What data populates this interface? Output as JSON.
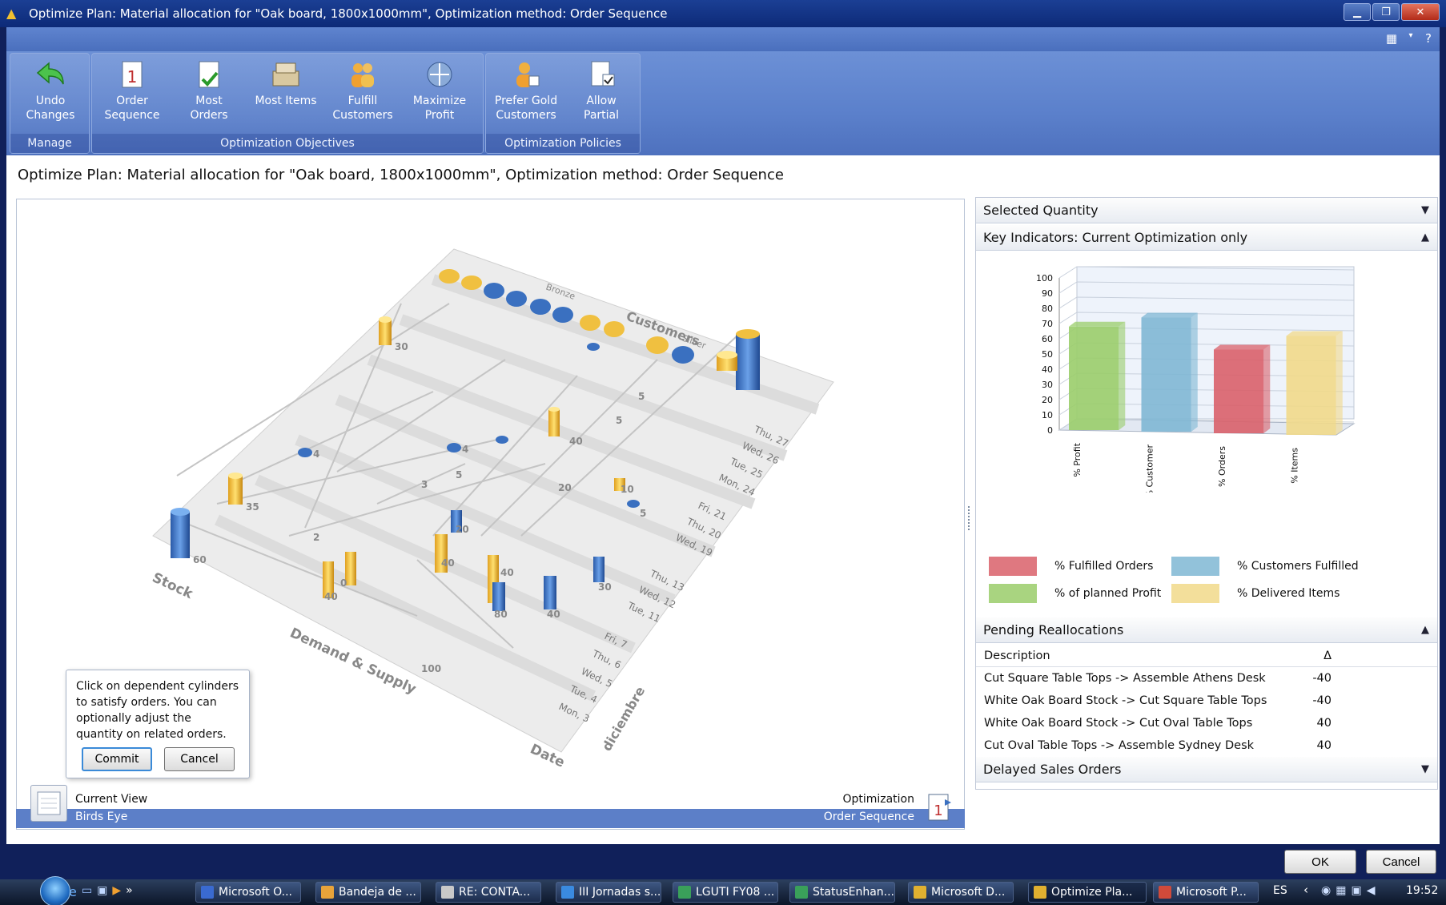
{
  "window": {
    "title": "Optimize Plan: Material allocation for \"Oak board, 1800x1000mm\", Optimization method: Order Sequence"
  },
  "ribbon": {
    "groups": [
      {
        "title": "Manage",
        "buttons": [
          {
            "line1": "Undo",
            "line2": "Changes",
            "icon": "undo-arrow-icon"
          }
        ]
      },
      {
        "title": "Optimization Objectives",
        "buttons": [
          {
            "line1": "Order",
            "line2": "Sequence",
            "icon": "order-sequence-icon"
          },
          {
            "line1": "Most",
            "line2": "Orders",
            "icon": "most-orders-icon"
          },
          {
            "line1": "Most Items",
            "line2": "",
            "icon": "most-items-icon"
          },
          {
            "line1": "Fulfill",
            "line2": "Customers",
            "icon": "fulfill-customers-icon"
          },
          {
            "line1": "Maximize",
            "line2": "Profit",
            "icon": "maximize-profit-icon"
          }
        ]
      },
      {
        "title": "Optimization Policies",
        "buttons": [
          {
            "line1": "Prefer Gold",
            "line2": "Customers",
            "icon": "gold-customer-icon"
          },
          {
            "line1": "Allow",
            "line2": "Partial",
            "icon": "allow-partial-icon"
          }
        ]
      }
    ]
  },
  "page": {
    "title": "Optimize Plan: Material allocation for \"Oak board, 1800x1000mm\", Optimization method: Order Sequence"
  },
  "view3d": {
    "axis_labels": {
      "customers": "Customers",
      "stock": "Stock",
      "demand": "Demand & Supply",
      "date": "Date",
      "month": "diciembre"
    },
    "tier_labels": {
      "bronze": "Bronze",
      "silver": "Silver"
    },
    "dates": [
      "Thu, 27",
      "Wed, 26",
      "Tue, 25",
      "Mon, 24",
      "Fri, 21",
      "Thu, 20",
      "Wed, 19",
      "Thu, 13",
      "Wed, 12",
      "Tue, 11",
      "Fri, 7",
      "Thu, 6",
      "Wed, 5",
      "Tue, 4",
      "Mon, 3"
    ],
    "quantities": [
      "30",
      "35",
      "60",
      "40",
      "100",
      "40",
      "20",
      "20",
      "10",
      "5",
      "30",
      "40",
      "80",
      "40",
      "5",
      "5",
      "4",
      "4",
      "2",
      "3",
      "5",
      "0",
      "40"
    ],
    "current_view_label": "Current View",
    "current_view_value": "Birds Eye",
    "optimization_label": "Optimization",
    "optimization_value": "Order Sequence"
  },
  "tip": {
    "text": "Click on dependent cylinders to satisfy orders. You can optionally adjust the quantity on related orders.",
    "commit_label": "Commit",
    "cancel_label": "Cancel"
  },
  "panel": {
    "selected_quantity": "Selected Quantity",
    "key_indicators": "Key Indicators: Current Optimization only",
    "pending_reallocations": "Pending Reallocations",
    "delayed_sales_orders": "Delayed Sales Orders",
    "table_headers": {
      "description": "Description",
      "delta": "Δ"
    },
    "rows": [
      {
        "description": "Cut Square Table Tops -> Assemble Athens Desk",
        "delta": "-40"
      },
      {
        "description": "White Oak Board Stock -> Cut Square Table Tops",
        "delta": "-40"
      },
      {
        "description": "White Oak Board Stock -> Cut Oval Table Tops",
        "delta": "40"
      },
      {
        "description": "Cut Oval Table Tops -> Assemble Sydney Desk",
        "delta": "40"
      }
    ]
  },
  "chart_data": {
    "type": "bar",
    "categories": [
      "% Profit",
      "% Customer",
      "% Orders",
      "% Items"
    ],
    "values": [
      68,
      75,
      55,
      65
    ],
    "colors": [
      "#9acd6a",
      "#7fb7d4",
      "#d9606a",
      "#f1d98a"
    ],
    "ylim": [
      0,
      100
    ],
    "yticks": [
      0,
      10,
      20,
      30,
      40,
      50,
      60,
      70,
      80,
      90,
      100
    ],
    "legend": [
      {
        "label": "% Fulfilled Orders",
        "color": "#d9606a"
      },
      {
        "label": "% Customers Fulfilled",
        "color": "#7fb7d4"
      },
      {
        "label": "% of planned Profit",
        "color": "#9acd6a"
      },
      {
        "label": "% Delivered Items",
        "color": "#f1d98a"
      }
    ]
  },
  "dialog": {
    "ok_label": "OK",
    "cancel_label": "Cancel"
  },
  "taskbar": {
    "items": [
      {
        "label": "Microsoft O...",
        "color": "#3a6ad0"
      },
      {
        "label": "Bandeja de ...",
        "color": "#e8a33a"
      },
      {
        "label": "RE: CONTA...",
        "color": "#c8c8c8"
      },
      {
        "label": "III Jornadas s...",
        "color": "#3a8ae0"
      },
      {
        "label": "LGUTI FY08 ...",
        "color": "#3aa05a"
      },
      {
        "label": "StatusEnhan...",
        "color": "#3aa05a"
      },
      {
        "label": "Microsoft D...",
        "color": "#e0b030"
      },
      {
        "label": "Optimize Pla...",
        "color": "#e0b030"
      },
      {
        "label": "Microsoft P...",
        "color": "#d04a3a"
      }
    ],
    "language": "ES",
    "clock": "19:52"
  }
}
